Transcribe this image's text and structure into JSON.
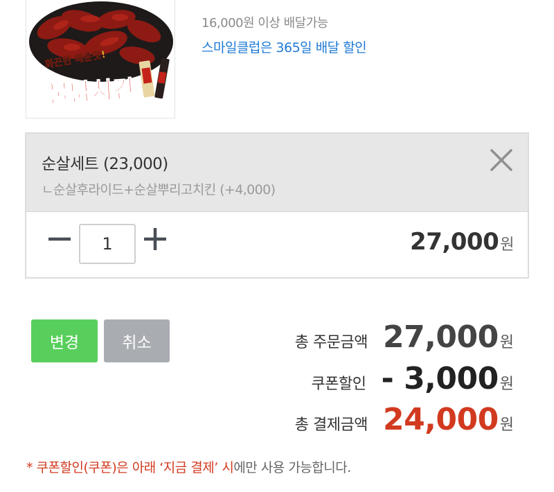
{
  "product": {
    "image_title": "불닭치킨",
    "image_slogan": "화끈한 매운맛!",
    "delivery_min": "16,000원 이상 배달가능",
    "smile_club": "스마일클럽은 365일 배달 할인"
  },
  "option": {
    "title": "순살세트 (23,000)",
    "subtitle": "ㄴ순살후라이드+순살뿌리고치킨 (+4,000)",
    "quantity": "1",
    "price": "27,000",
    "currency": "원"
  },
  "actions": {
    "change_label": "변경",
    "cancel_label": "취소"
  },
  "summary": {
    "total_label": "총 주문금액",
    "total_value": "27,000",
    "coupon_label": "쿠폰할인",
    "coupon_value": "- 3,000",
    "pay_label": "총 결제금액",
    "pay_value": "24,000",
    "currency": "원"
  },
  "note": {
    "red_part": "* 쿠폰할인(쿠폰)은 아래 ‘지금 결제’ 시",
    "gray_part": "에만 사용 가능합니다."
  },
  "colors": {
    "accent_green": "#58cf5c",
    "cancel_gray": "#a9acb1",
    "link_blue": "#1e7ad6",
    "price_red": "#d23a20"
  }
}
